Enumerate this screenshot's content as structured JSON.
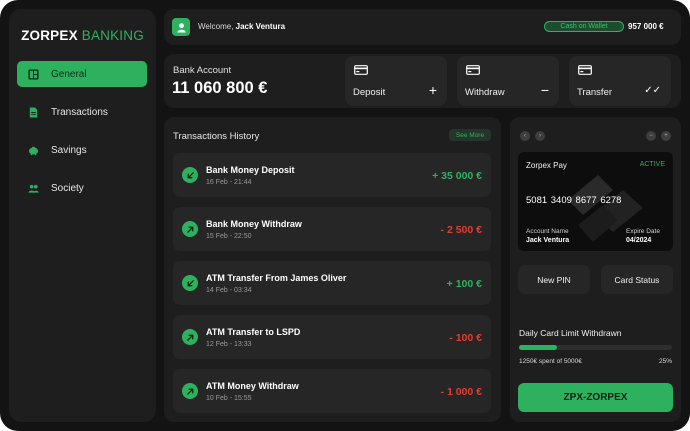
{
  "brand": {
    "name_part1": "ZORPEX",
    "name_part2": "BANKING"
  },
  "sidebar": {
    "items": [
      {
        "label": "General",
        "icon": "dashboard-icon",
        "active": true
      },
      {
        "label": "Transactions",
        "icon": "document-icon",
        "active": false
      },
      {
        "label": "Savings",
        "icon": "piggy-bank-icon",
        "active": false
      },
      {
        "label": "Society",
        "icon": "group-icon",
        "active": false
      }
    ]
  },
  "header": {
    "welcome_prefix": "Welcome,",
    "user_name": "Jack Ventura",
    "cash_label": "Cash on Wallet",
    "cash_amount": "957 000 €"
  },
  "account": {
    "label": "Bank Account",
    "balance": "11 060 800 €"
  },
  "actions": [
    {
      "label": "Deposit",
      "symbol": "+"
    },
    {
      "label": "Withdraw",
      "symbol": "−"
    },
    {
      "label": "Transfer",
      "symbol": "✓✓"
    }
  ],
  "transactions": {
    "title": "Transactions History",
    "see_more": "See More",
    "items": [
      {
        "name": "Bank Money Deposit",
        "date": "16 Feb - 21:44",
        "amount": "+ 35 000 €",
        "direction": "in"
      },
      {
        "name": "Bank Money Withdraw",
        "date": "15 Feb - 22:50",
        "amount": "- 2 500 €",
        "direction": "out"
      },
      {
        "name": "ATM Transfer From James Oliver",
        "date": "14 Feb - 03:34",
        "amount": "+ 100 €",
        "direction": "in"
      },
      {
        "name": "ATM Transfer to LSPD",
        "date": "12 Feb - 13:33",
        "amount": "- 100 €",
        "direction": "out"
      },
      {
        "name": "ATM Money Withdraw",
        "date": "10 Feb - 15:55",
        "amount": "- 1 000 €",
        "direction": "out"
      }
    ]
  },
  "card": {
    "brand": "Zorpex Pay",
    "status": "ACTIVE",
    "number": "5081 3409 8677 6278",
    "account_name_label": "Account Name",
    "account_name": "Jack Ventura",
    "expire_label": "Expire Date",
    "expire": "04/2024",
    "new_pin": "New PIN",
    "card_status": "Card Status"
  },
  "limit": {
    "title": "Daily Card Limit Withdrawn",
    "spent_text": "1250€ spent of 5000€",
    "percent_text": "25%",
    "fraction": 0.25
  },
  "footer_button": "ZPX-ZORPEX",
  "colors": {
    "accent": "#2db15f",
    "negative": "#e63c30",
    "panel": "#1e1e1e",
    "background": "#131313"
  }
}
